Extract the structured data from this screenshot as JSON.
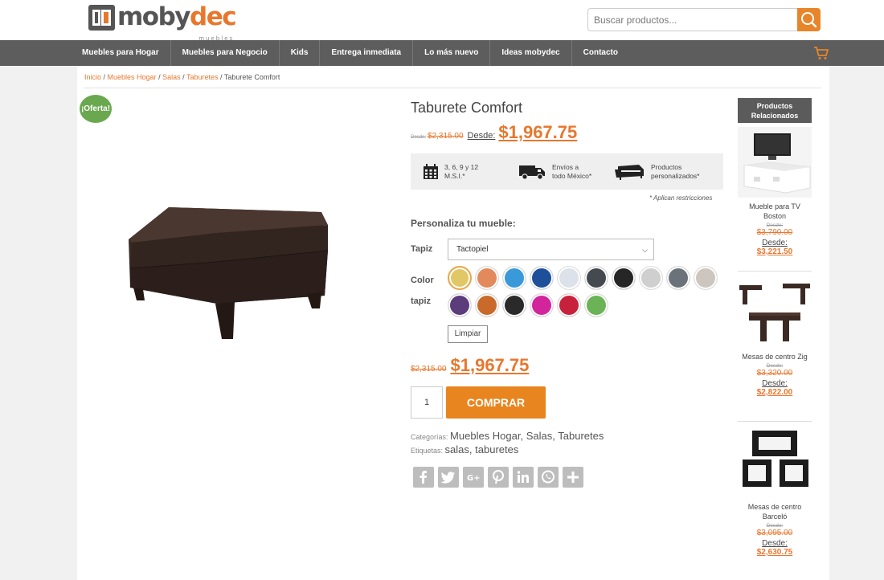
{
  "logo": {
    "text_main": "moby",
    "text_accent": "dec",
    "sub": "muebles"
  },
  "search": {
    "placeholder": "Buscar productos..."
  },
  "nav": [
    "Muebles para Hogar",
    "Muebles para Negocio",
    "Kids",
    "Entrega inmediata",
    "Lo más nuevo",
    "Ideas mobydec",
    "Contacto"
  ],
  "breadcrumb": {
    "inicio": "Inicio",
    "muebles_hogar": "Muebles Hogar",
    "salas": "Salas",
    "taburetes": "Taburetes",
    "current": "Taburete Comfort",
    "sep": " / "
  },
  "badge": "¡Oferta!",
  "product": {
    "title": "Taburete Comfort",
    "desde_small": "Desde:",
    "old_price": "$2,315.00",
    "desde": "Desde:",
    "price": "$1,967.75"
  },
  "features": [
    {
      "icon": "calendar-icon",
      "line1": "3, 6, 9 y 12",
      "line2": "M.S.I.*"
    },
    {
      "icon": "truck-icon",
      "line1": "Envíos a",
      "line2": "todo México*"
    },
    {
      "icon": "sofa-icon",
      "line1": "Productos",
      "line2": "personalizados*"
    }
  ],
  "restrictions": "* Aplican restricciones",
  "customize": {
    "title": "Personaliza tu mueble:",
    "tapiz_label": "Tapiz",
    "tapiz_value": "Tactopiel",
    "color_label": "Color tapiz",
    "swatches": [
      "#e2c766",
      "#e28a5c",
      "#3a9ad9",
      "#1e4f9a",
      "#dde2ea",
      "#454a50",
      "#262626",
      "#cfcfcf",
      "#6c727a",
      "#ccc6bf",
      "#5b3d7c",
      "#c96a2a",
      "#2a2a2a",
      "#d2259c",
      "#c8213c",
      "#6bb356"
    ],
    "selected_index": 0,
    "clear_label": "Limpiar"
  },
  "purchase": {
    "old_price": "$2,315.00",
    "price": "$1,967.75",
    "quantity": "1",
    "buy_label": "COMPRAR"
  },
  "meta": {
    "cat_label": "Categorías:",
    "categories": [
      "Muebles Hogar",
      "Salas",
      "Taburetes"
    ],
    "tag_label": "Etiquetas:",
    "tags": [
      "salas",
      "taburetes"
    ]
  },
  "share": [
    "facebook-icon",
    "twitter-icon",
    "google-plus-icon",
    "pinterest-icon",
    "linkedin-icon",
    "whatsapp-icon",
    "plus-icon"
  ],
  "related": {
    "title": "Productos Relacionados",
    "items": [
      {
        "name": "Mueble para TV Boston",
        "desde_small": "Desde:",
        "old_price": "$3,790.00",
        "desde": "Desde:",
        "price": "$3,221.50"
      },
      {
        "name": "Mesas de centro Zig",
        "desde_small": "Desde:",
        "old_price": "$3,320.00",
        "desde": "Desde:",
        "price": "$2,822.00"
      },
      {
        "name": "Mesas de centro Barceló",
        "desde_small": "Desde:",
        "old_price": "$3,095.00",
        "desde": "Desde:",
        "price": "$2,630.75"
      }
    ]
  },
  "colors": {
    "accent": "#e8772e",
    "nav_bg": "#5d5d5d",
    "badge": "#6aa84f"
  }
}
